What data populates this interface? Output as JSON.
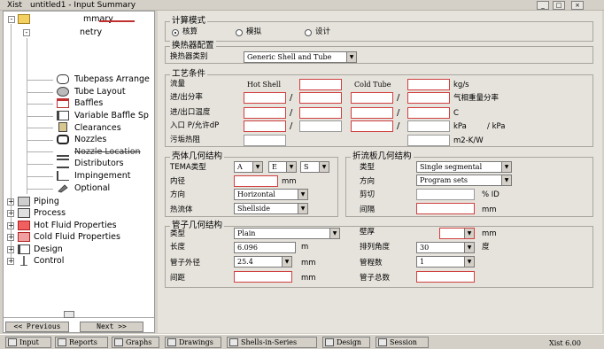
{
  "window": {
    "title": "Xist",
    "title_doc": "untitled1 - Input Summary",
    "minimize": "_",
    "maximize": "□",
    "close": "×"
  },
  "tree": {
    "root_label": "mmary",
    "child_label": "netry",
    "items": [
      {
        "label": "Tubepass Arrange",
        "icon": "tubepass-icon"
      },
      {
        "label": "Tube Layout",
        "icon": "tube-layout-icon"
      },
      {
        "label": "Baffles",
        "icon": "baffles-icon"
      },
      {
        "label": "Variable Baffle Sp",
        "icon": "variable-baffle-icon"
      },
      {
        "label": "Clearances",
        "icon": "clearances-icon"
      },
      {
        "label": "Nozzles",
        "icon": "nozzles-icon"
      },
      {
        "label": "Nozzle Location",
        "icon": "nozzle-location-icon"
      },
      {
        "label": "Distributors",
        "icon": "distributors-icon"
      },
      {
        "label": "Impingement",
        "icon": "impingement-icon"
      },
      {
        "label": "Optional",
        "icon": "optional-icon"
      }
    ],
    "top_items": [
      {
        "label": "Piping",
        "icon": "piping-icon"
      },
      {
        "label": "Process",
        "icon": "process-icon"
      },
      {
        "label": "Hot Fluid Properties",
        "icon": "hot-fluid-icon"
      },
      {
        "label": "Cold Fluid Properties",
        "icon": "cold-fluid-icon"
      },
      {
        "label": "Design",
        "icon": "design-icon"
      },
      {
        "label": "Control",
        "icon": "control-icon"
      }
    ],
    "prev_button": "<< Previous",
    "next_button": "Next >>"
  },
  "calc_mode": {
    "title": "计算模式",
    "options": [
      "核算",
      "模拟",
      "设计"
    ],
    "selected": "核算"
  },
  "exchanger": {
    "title": "换热器配置",
    "type_label": "换热器类别",
    "type_value": "Generic Shell and Tube"
  },
  "process": {
    "title": "工艺条件",
    "col_hot": "Hot Shell",
    "col_cold": "Cold Tube",
    "rows": [
      {
        "label": "流量",
        "unit": "kg/s"
      },
      {
        "label": "进/出分率",
        "unit": "气相重量分率"
      },
      {
        "label": "进/出口温度",
        "unit": "C"
      },
      {
        "label": "入口 P/允许dP",
        "unit": "kPa",
        "unit2": "/ kPa"
      },
      {
        "label": "污垢热阻",
        "unit": "m2-K/W"
      }
    ]
  },
  "shell": {
    "title": "壳体几何结构",
    "tema_label": "TEMA类型",
    "tema_values": [
      "A",
      "E",
      "S"
    ],
    "id_label": "内径",
    "id_unit": "mm",
    "orient_label": "方向",
    "orient_value": "Horizontal",
    "hot_label": "热流体",
    "hot_value": "Shellside"
  },
  "baffle": {
    "title": "折流板几何结构",
    "type_label": "类型",
    "type_value": "Single segmental",
    "orient_label": "方向",
    "orient_value": "Program sets",
    "cut_label": "剪切",
    "cut_unit": "% ID",
    "spacing_label": "间隔",
    "spacing_unit": "mm"
  },
  "tube": {
    "title": "管子几何结构",
    "type_label": "类型",
    "type_value": "Plain",
    "wall_label": "壁厚",
    "wall_unit": "mm",
    "length_label": "长度",
    "length_value": "6.096",
    "length_unit": "m",
    "angle_label": "排列角度",
    "angle_value": "30",
    "angle_unit": "度",
    "od_label": "管子外径",
    "od_value": "25.4",
    "od_unit": "mm",
    "passes_label": "管程数",
    "passes_value": "1",
    "pitch_label": "间距",
    "pitch_unit": "mm",
    "count_label": "管子总数"
  },
  "tabs": [
    "Input",
    "Reports",
    "Graphs",
    "Drawings",
    "Shells-in-Series",
    "Design",
    "Session"
  ],
  "version": "Xist 6.00"
}
